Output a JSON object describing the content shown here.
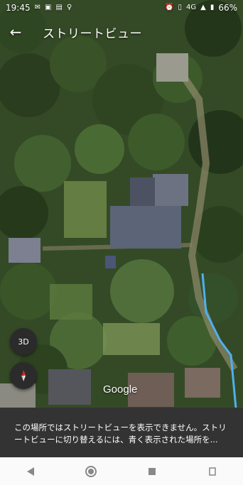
{
  "status_bar": {
    "time": "19:45",
    "network": "4G",
    "battery": "66%"
  },
  "app_bar": {
    "back_icon": "arrow-left-icon",
    "title": "ストリートビュー"
  },
  "map": {
    "view_type": "satellite",
    "streetview_line_color": "#4fb0f0",
    "attribution": "Google"
  },
  "controls": {
    "three_d_label": "3D",
    "compass_icon": "compass-icon"
  },
  "snackbar": {
    "message": "この場所ではストリートビューを表示できません。ストリートビューに切り替えるには、青く表示された場所を..."
  },
  "nav": {
    "back": "nav-back-icon",
    "home": "nav-home-icon",
    "recents": "nav-recents-icon",
    "rotate": "nav-rotate-icon"
  }
}
